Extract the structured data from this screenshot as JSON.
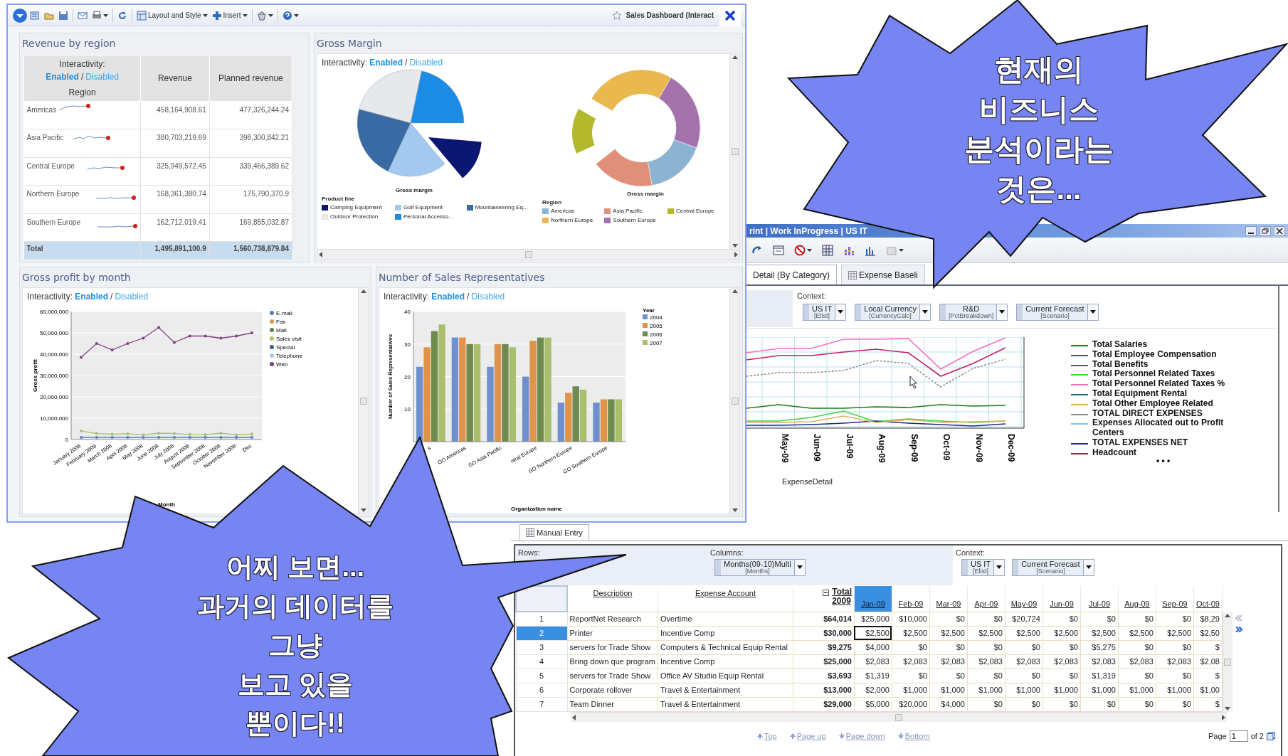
{
  "dashboard": {
    "toolbar_menus": [
      {
        "label": "Layout and Style"
      },
      {
        "label": "Insert"
      }
    ],
    "title": "Sales Dashboard (Interact",
    "revenue": {
      "title": "Revenue by region",
      "interactivity": {
        "label": "Interactivity:",
        "separator": "/",
        "options": [
          {
            "text": "Enabled",
            "selected": true
          },
          {
            "text": "Disabled",
            "selected": false
          }
        ]
      },
      "columns": [
        "Region",
        "Revenue",
        "Planned revenue"
      ],
      "rows": [
        {
          "region": "Americas",
          "revenue": "458,164,908.61",
          "planned": "477,326,244.24"
        },
        {
          "region": "Asia Pacific",
          "revenue": "380,703,219.69",
          "planned": "398,300,842.21"
        },
        {
          "region": "Central Europe",
          "revenue": "325,949,572.45",
          "planned": "339,466,389.62"
        },
        {
          "region": "Northern Europe",
          "revenue": "168,361,380.74",
          "planned": "175,790,370.9"
        },
        {
          "region": "Southern Europe",
          "revenue": "162,712,019.41",
          "planned": "169,855,032.87"
        }
      ],
      "total": {
        "label": "Total",
        "revenue": "1,495,891,100.9",
        "planned": "1,560,738,879.84"
      }
    },
    "gross_margin": {
      "title": "Gross Margin",
      "interactivity": {
        "label": "Interactivity:",
        "separator": "/",
        "options": [
          {
            "text": "Enabled",
            "selected": true
          },
          {
            "text": "Disabled",
            "selected": false
          }
        ]
      },
      "pie": {
        "title": "Gross margin",
        "legend_title": "Product line",
        "legend": [
          {
            "label": "Camping Equipment",
            "color": "#0b1670"
          },
          {
            "label": "Golf Equipment",
            "color": "#a3c9f0"
          },
          {
            "label": "Mountaineering Eq...",
            "color": "#3a6aa3"
          },
          {
            "label": "Outdoor Protection",
            "color": "#e6e8ec"
          },
          {
            "label": "Personal Accesso...",
            "color": "#1b8be3"
          }
        ]
      },
      "donut": {
        "title": "Gross margin",
        "legend_title": "Region",
        "legend": [
          {
            "label": "Americas",
            "color": "#8db3d3"
          },
          {
            "label": "Asia Pacific",
            "color": "#e0907a"
          },
          {
            "label": "Central Europe",
            "color": "#b3b82c"
          },
          {
            "label": "Northern Europe",
            "color": "#e9b84e"
          },
          {
            "label": "Southern Europe",
            "color": "#a472ab"
          }
        ]
      }
    },
    "gross_profit": {
      "title": "Gross profit by month",
      "interactivity": {
        "label": "Interactivity:",
        "separator": "/",
        "options": [
          {
            "text": "Enabled",
            "selected": true
          },
          {
            "text": "Disabled",
            "selected": false
          }
        ]
      },
      "chart_data": {
        "type": "line",
        "grid": true,
        "legend": true,
        "xlabel": "Month",
        "ylabel": "Gross profit",
        "categories": [
          "January 2008",
          "February 2008",
          "March 2008",
          "April 2008",
          "May 2008",
          "June 2008",
          "July 2008",
          "August 2008",
          "September 2008",
          "October 2008",
          "November 2008",
          "Dec"
        ],
        "ylim": [
          0,
          60000000
        ],
        "yticks": [
          {
            "value": 0,
            "label": "0"
          },
          {
            "value": 10000000,
            "label": "10,000,000"
          },
          {
            "value": 20000000,
            "label": "20,000,000"
          },
          {
            "value": 30000000,
            "label": "30,000,000"
          },
          {
            "value": 40000000,
            "label": "40,000,000"
          },
          {
            "value": 50000000,
            "label": "50,000,000"
          },
          {
            "value": 60000000,
            "label": "60,000,000"
          }
        ],
        "series": [
          {
            "name": "E-mail",
            "color": "#5a7cc8",
            "values": [
              1000000,
              1000000,
              1000000,
              1000000,
              1000000,
              1000000,
              1000000,
              1000000,
              1000000,
              1000000,
              1000000,
              1000000
            ]
          },
          {
            "name": "Fax",
            "color": "#e0944a",
            "values": [
              null,
              null,
              null,
              null,
              null,
              null,
              null,
              null,
              null,
              null,
              null,
              null
            ]
          },
          {
            "name": "Mail",
            "color": "#5f7f3f",
            "values": [
              null,
              null,
              null,
              null,
              null,
              null,
              null,
              null,
              null,
              null,
              null,
              null
            ]
          },
          {
            "name": "Sales visit",
            "color": "#a9c36a",
            "values": [
              4000000,
              2800000,
              2500000,
              2700000,
              2200000,
              3000000,
              2800000,
              2400000,
              2300000,
              3000000,
              2200000,
              2600000
            ]
          },
          {
            "name": "Special",
            "color": "#3f5f7f",
            "values": [
              null,
              null,
              null,
              null,
              null,
              null,
              null,
              null,
              null,
              null,
              null,
              null
            ]
          },
          {
            "name": "Telephone",
            "color": "#a9c6e8",
            "values": [
              null,
              null,
              null,
              null,
              null,
              null,
              null,
              null,
              null,
              null,
              null,
              null
            ]
          },
          {
            "name": "Web",
            "color": "#7f3f7f",
            "values": [
              38500000,
              45000000,
              42000000,
              45000000,
              47500000,
              52500000,
              45500000,
              48500000,
              48500000,
              47500000,
              48500000,
              50000000
            ]
          }
        ]
      }
    },
    "sales_reps": {
      "title": "Number of Sales Representatives",
      "interactivity": {
        "label": "Interactivity:",
        "separator": "/",
        "options": [
          {
            "text": "Enabled",
            "selected": true
          },
          {
            "text": "Disabled",
            "selected": false
          }
        ]
      },
      "chart_data": {
        "type": "bar",
        "grid": true,
        "legend": true,
        "xlabel": "Organization name",
        "ylabel": "Number of Sales Representatives",
        "legend_title": "Year",
        "categories": [
          "s",
          "GO Americas",
          "GO Asia Pacific",
          "ntral Europe",
          "GO Northern Europe",
          "GO Southern Europe"
        ],
        "ylim": [
          0,
          40
        ],
        "yticks": [
          10,
          20,
          30,
          40
        ],
        "series": [
          {
            "name": "2004",
            "color": "#6f8fcf",
            "values": [
              23,
              32,
              23,
              20,
              12,
              12
            ]
          },
          {
            "name": "2005",
            "color": "#e0944a",
            "values": [
              29,
              32,
              30,
              31,
              15,
              13
            ]
          },
          {
            "name": "2006",
            "color": "#6e8a4f",
            "values": [
              34,
              30,
              30,
              32,
              17,
              13
            ]
          },
          {
            "name": "2007",
            "color": "#a9bf6e",
            "values": [
              36,
              30,
              29,
              32,
              16,
              13
            ]
          }
        ]
      }
    }
  },
  "planning": {
    "title": "rint | Work InProgress | US IT",
    "tabs": [
      {
        "label": "Detail (By Category)",
        "selected": true
      },
      {
        "label": "Expense Baseli",
        "selected": false
      }
    ],
    "context_label": "Context:",
    "context": [
      {
        "name": "US IT",
        "dimension": "[Elist]"
      },
      {
        "name": "Local Currency",
        "dimension": "[CurrencyCalc]"
      },
      {
        "name": "R&D",
        "dimension": "[PctBreakdown]"
      },
      {
        "name": "Current Forecast",
        "dimension": "[Scenario]"
      }
    ],
    "x_labels": [
      "May-09",
      "Jun-09",
      "Jul-09",
      "Aug-09",
      "Sep-09",
      "Oct-09",
      "Nov-09",
      "Dec-09"
    ],
    "axis_title": "ExpenseDetail",
    "legend": [
      {
        "label": "Total Salaries",
        "color": "#1a7a1a"
      },
      {
        "label": "Total Employee Compensation",
        "color": "#4848e0"
      },
      {
        "label": "Total Benefits",
        "color": "#c0206a"
      },
      {
        "label": "Total Personnel Related Taxes",
        "color": "#40d040"
      },
      {
        "label": "Total Personnel Related Taxes %",
        "color": "#f070c0"
      },
      {
        "label": "Total Equipment Rental",
        "color": "#207070"
      },
      {
        "label": "Total Other Employee Related",
        "color": "#e0b060"
      },
      {
        "label": "TOTAL DIRECT EXPENSES",
        "color": "#909090"
      },
      {
        "label": "Expenses Allocated out to Profit Centers",
        "color": "#80c4f0"
      },
      {
        "label": "TOTAL EXPENSES NET",
        "color": "#1a2a8a"
      },
      {
        "label": "Headcount",
        "color": "#803030"
      }
    ],
    "more": "• • •"
  },
  "entry": {
    "tab": {
      "label": "Manual Entry",
      "selected": true
    },
    "rows_label": "Rows:",
    "columns_label": "Columns:",
    "columns_chip": {
      "name": "Months(09-10)Multi",
      "dimension": "[Months]"
    },
    "context_label": "Context:",
    "context": [
      {
        "name": "US IT",
        "dimension": "[Elist]"
      },
      {
        "name": "Current Forecast",
        "dimension": "[Scenario]"
      }
    ],
    "columns": [
      {
        "label": "Description",
        "kind": "text"
      },
      {
        "label": "Expense Account",
        "kind": "text"
      },
      {
        "label": "Total\n2009",
        "kind": "total"
      }
    ],
    "months": [
      {
        "label": "Jan-09",
        "selected": true
      },
      {
        "label": "Feb-09",
        "selected": false
      },
      {
        "label": "Mar-09",
        "selected": false
      },
      {
        "label": "Apr-09",
        "selected": false
      },
      {
        "label": "May-09",
        "selected": false
      },
      {
        "label": "Jun-09",
        "selected": false
      },
      {
        "label": "Jul-09",
        "selected": false
      },
      {
        "label": "Aug-09",
        "selected": false
      },
      {
        "label": "Sep-09",
        "selected": false
      },
      {
        "label": "Oct-09",
        "selected": false
      }
    ],
    "rows": [
      {
        "number": "1",
        "selected": false,
        "description": "ReportNet Research",
        "account": "Overtime",
        "total": "$64,014",
        "values": [
          "$25,000",
          "$10,000",
          "$0",
          "$0",
          "$20,724",
          "$0",
          "$0",
          "$0",
          "$0",
          "$8,29"
        ]
      },
      {
        "number": "2",
        "selected": true,
        "description": "Printer",
        "account": "Incentive Comp",
        "total": "$30,000",
        "values": [
          "$2,500",
          "$2,500",
          "$2,500",
          "$2,500",
          "$2,500",
          "$2,500",
          "$2,500",
          "$2,500",
          "$2,500",
          "$2,50"
        ]
      },
      {
        "number": "3",
        "selected": false,
        "description": "servers for Trade Show",
        "account": "Computers & Technical Equip Rental",
        "total": "$9,275",
        "values": [
          "$4,000",
          "$0",
          "$0",
          "$0",
          "$0",
          "$0",
          "$5,275",
          "$0",
          "$0",
          "$"
        ]
      },
      {
        "number": "4",
        "selected": false,
        "description": "Bring down que program",
        "account": "Incentive Comp",
        "total": "$25,000",
        "values": [
          "$2,083",
          "$2,083",
          "$2,083",
          "$2,083",
          "$2,083",
          "$2,083",
          "$2,083",
          "$2,083",
          "$2,083",
          "$2,08"
        ]
      },
      {
        "number": "5",
        "selected": false,
        "description": "servers for Trade Show",
        "account": "Office AV Studio Equip Rental",
        "total": "$3,693",
        "values": [
          "$1,319",
          "$0",
          "$0",
          "$0",
          "$0",
          "$0",
          "$1,319",
          "$0",
          "$0",
          "$"
        ]
      },
      {
        "number": "6",
        "selected": false,
        "description": "Corporate rollover",
        "account": "Travel & Entertainment",
        "total": "$13,000",
        "values": [
          "$2,000",
          "$1,000",
          "$1,000",
          "$1,000",
          "$1,000",
          "$1,000",
          "$1,000",
          "$1,000",
          "$1,000",
          "$1,00"
        ]
      },
      {
        "number": "7",
        "selected": false,
        "description": "Team Dinner",
        "account": "Travel & Entertainment",
        "total": "$29,000",
        "values": [
          "$5,000",
          "$20,000",
          "$4,000",
          "$0",
          "$0",
          "$0",
          "$0",
          "$0",
          "$0",
          "$"
        ]
      }
    ],
    "pager": {
      "top": "Top",
      "page_up": "Page up",
      "page_down": "Page down",
      "bottom": "Bottom",
      "page_label": "Page",
      "page": "1",
      "of": "of 2"
    }
  },
  "callouts": [
    {
      "kind": "top",
      "text": "현재의\n비즈니스\n분석이라는\n것은..."
    },
    {
      "kind": "bottom",
      "text": "어찌 보면...\n과거의 데이터를\n그냥\n보고 있을\n뿐이다!!"
    }
  ]
}
